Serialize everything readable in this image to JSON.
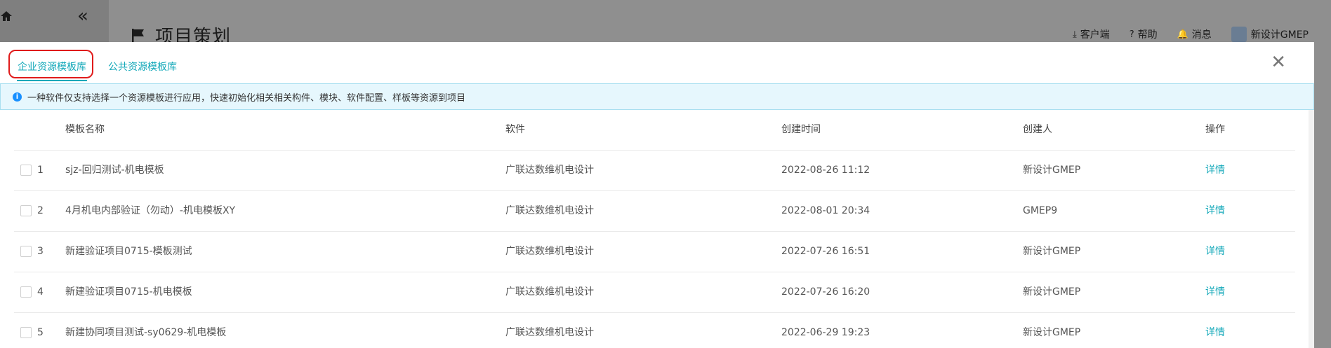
{
  "background": {
    "page_title": "项目策划",
    "topbar": {
      "client": "客户端",
      "help": "帮助",
      "messages": "消息",
      "user": "新设计GMEP"
    }
  },
  "modal": {
    "tabs": [
      {
        "label": "企业资源模板库",
        "active": true
      },
      {
        "label": "公共资源模板库",
        "active": false
      }
    ],
    "notice": "一种软件仅支持选择一个资源模板进行应用，快速初始化相关相关构件、模块、软件配置、样板等资源到项目",
    "table": {
      "headers": {
        "name": "模板名称",
        "software": "软件",
        "created_time": "创建时间",
        "creator": "创建人",
        "action": "操作"
      },
      "rows": [
        {
          "index": "1",
          "name": "sjz-回归测试-机电模板",
          "software": "广联达数维机电设计",
          "created_time": "2022-08-26 11:12",
          "creator": "新设计GMEP",
          "action": "详情"
        },
        {
          "index": "2",
          "name": "4月机电内部验证（勿动）-机电模板XY",
          "software": "广联达数维机电设计",
          "created_time": "2022-08-01 20:34",
          "creator": "GMEP9",
          "action": "详情"
        },
        {
          "index": "3",
          "name": "新建验证项目0715-模板测试",
          "software": "广联达数维机电设计",
          "created_time": "2022-07-26 16:51",
          "creator": "新设计GMEP",
          "action": "详情"
        },
        {
          "index": "4",
          "name": "新建验证项目0715-机电模板",
          "software": "广联达数维机电设计",
          "created_time": "2022-07-26 16:20",
          "creator": "新设计GMEP",
          "action": "详情"
        },
        {
          "index": "5",
          "name": "新建协同项目测试-sy0629-机电模板",
          "software": "广联达数维机电设计",
          "created_time": "2022-06-29 19:23",
          "creator": "新设计GMEP",
          "action": "详情"
        }
      ]
    }
  },
  "colors": {
    "accent": "#13a8b9",
    "highlight_ring": "#e01b1b",
    "notice_bg": "#e6f7fd",
    "info_icon": "#1890ff"
  }
}
